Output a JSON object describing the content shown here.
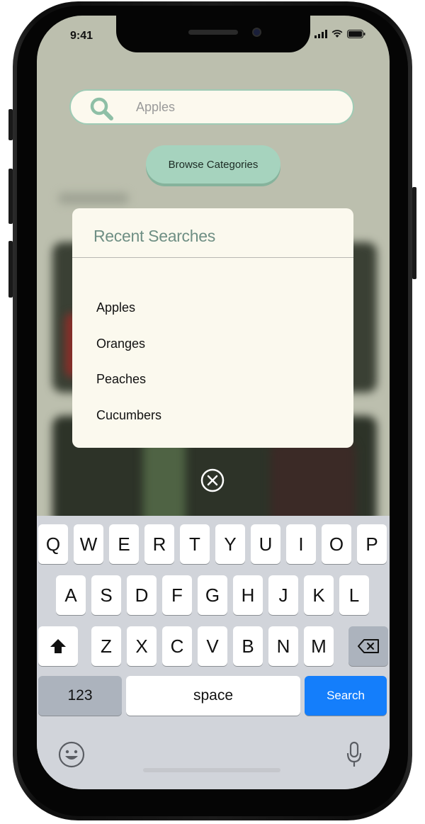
{
  "status_bar": {
    "time": "9:41"
  },
  "search": {
    "value": "Apples",
    "icon": "search-icon"
  },
  "browse_button": {
    "label": "Browse Categories"
  },
  "recent_searches": {
    "title": "Recent Searches",
    "items": [
      "Apples",
      "Oranges",
      "Peaches",
      "Cucumbers"
    ]
  },
  "keyboard": {
    "row1": [
      "Q",
      "W",
      "E",
      "R",
      "T",
      "Y",
      "U",
      "I",
      "O",
      "P"
    ],
    "row2": [
      "A",
      "S",
      "D",
      "F",
      "G",
      "H",
      "J",
      "K",
      "L"
    ],
    "row3": [
      "Z",
      "X",
      "C",
      "V",
      "B",
      "N",
      "M"
    ],
    "numbers_label": "123",
    "space_label": "space",
    "search_label": "Search"
  },
  "colors": {
    "accent_green": "#a6d3be",
    "panel_bg": "#fbf9ee",
    "search_key_blue": "#147efb",
    "title_green": "#6f8f84"
  }
}
